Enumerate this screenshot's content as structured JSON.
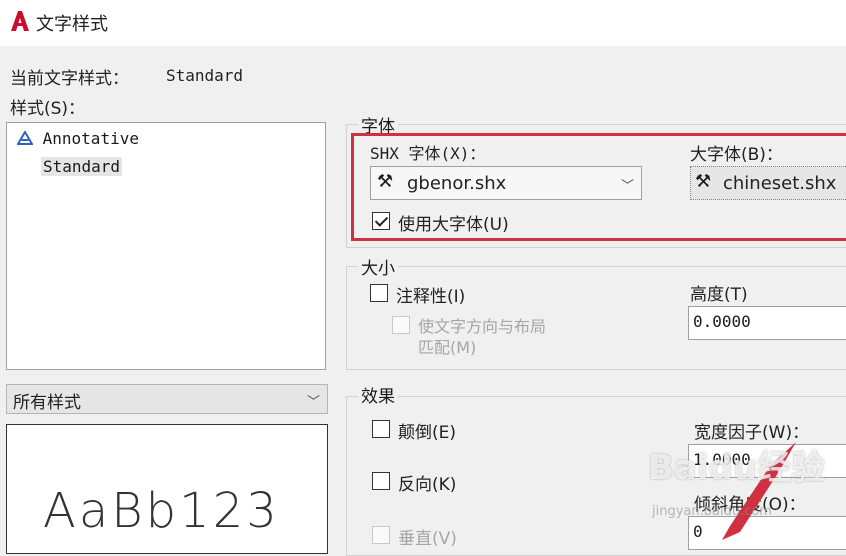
{
  "window": {
    "title": "文字样式",
    "logo_letter": "A"
  },
  "current_style": {
    "label": "当前文字样式：",
    "value": "Standard"
  },
  "styles": {
    "label": "样式(S)：",
    "items": [
      {
        "label": "Annotative",
        "annotative": true
      },
      {
        "label": "Standard",
        "selected": true
      }
    ]
  },
  "filter": {
    "selected": "所有样式"
  },
  "preview": {
    "text": "AaBb123"
  },
  "font_group": {
    "title": "字体",
    "shx_label": "SHX 字体(X)：",
    "shx_value": "gbenor.shx",
    "big_label": "大字体(B)：",
    "big_value": "chineset.shx",
    "use_big_font": {
      "label": "使用大字体(U)",
      "checked": true
    }
  },
  "size_group": {
    "title": "大小",
    "annotative": {
      "label": "注释性(I)",
      "checked": false
    },
    "match_layout": {
      "line1": "使文字方向与布局",
      "line2": "匹配(M)",
      "disabled": true
    },
    "height": {
      "label": "高度(T)",
      "value": "0.0000"
    }
  },
  "effects_group": {
    "title": "效果",
    "upside_down": {
      "label": "颠倒(E)",
      "checked": false
    },
    "backwards": {
      "label": "反向(K)",
      "checked": false
    },
    "vertical": {
      "label": "垂直(V)",
      "disabled": true
    },
    "width_factor": {
      "label": "宽度因子(W)：",
      "value": "1.0000"
    },
    "oblique_angle": {
      "label": "倾斜角度(O)：",
      "value": "0"
    }
  },
  "annotation": {
    "color": "#d03040"
  },
  "watermark": {
    "text": "Baidu经验",
    "sub": "jingyan.baidu.com"
  }
}
